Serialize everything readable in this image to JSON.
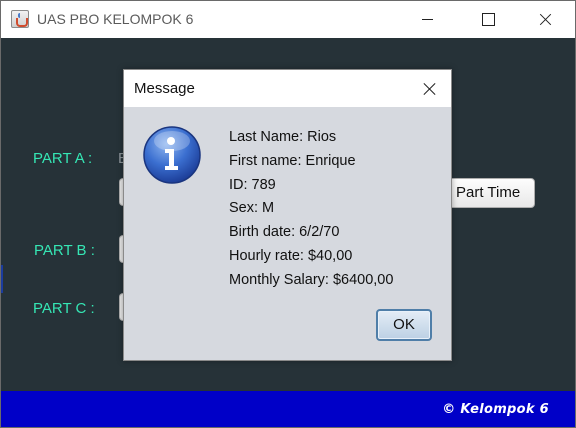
{
  "window": {
    "title": "UAS PBO KELOMPOK 6"
  },
  "form": {
    "part_a_label": "PART A :",
    "part_a_partial": "E",
    "part_b_label": "PART B :",
    "part_c_label": "PART C :",
    "part_time_button": "Part Time"
  },
  "footer": {
    "text": "© Kelompok 6"
  },
  "dialog": {
    "title": "Message",
    "icon": "info-icon",
    "lines": [
      "Last Name: Rios",
      "First name: Enrique",
      "ID: 789",
      "Sex: M",
      "Birth date: 6/2/70",
      "Hourly rate: $40,00",
      "Monthly Salary: $6400,00"
    ],
    "ok_button": "OK"
  },
  "colors": {
    "background": "#263238",
    "label": "#35e6b4",
    "footer": "#0000c8",
    "dialog": "#d6d9df"
  }
}
